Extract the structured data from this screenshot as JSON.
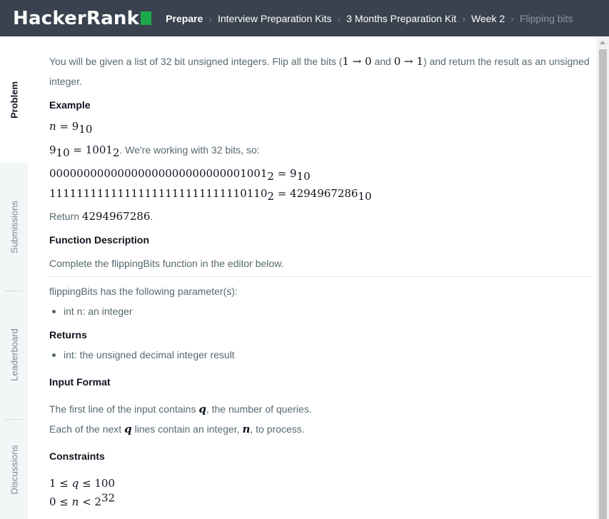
{
  "brand": {
    "name": "HackerRank"
  },
  "breadcrumb": [
    {
      "label": "Prepare"
    },
    {
      "label": "Interview Preparation Kits"
    },
    {
      "label": "3 Months Preparation Kit"
    },
    {
      "label": "Week 2"
    },
    {
      "label": "Flipping bits"
    }
  ],
  "sidebar": {
    "tabs": [
      {
        "label": "Problem"
      },
      {
        "label": "Submissions"
      },
      {
        "label": "Leaderboard"
      },
      {
        "label": "Discussions"
      }
    ]
  },
  "problem": {
    "intro_a": "You will be given a list of 32 bit unsigned integers. Flip all the bits (",
    "intro_m1": "1 → 0",
    "intro_and": " and ",
    "intro_m2": "0 → 1",
    "intro_b": ") and return the result as an unsigned integer.",
    "example_heading": "Example",
    "ex_n": "n",
    "ex_eq1": " = 9",
    "ex_sub10": "10",
    "ex_b1": "9",
    "ex_b2": " = 1001",
    "ex_sub2": "2",
    "ex_working": ". We're working with 32 bits, so:",
    "bin_line1": "00000000000000000000000000001001",
    "bin_line1_rhs": " = 9",
    "bin_line2": "11111111111111111111111111110110",
    "bin_line2_rhs": " = 4294967286",
    "return_pre": "Return ",
    "return_val": "4294967286",
    "return_post": ".",
    "func_heading": "Function Description",
    "func_desc": "Complete the flippingBits function in the editor below.",
    "params_intro": "flippingBits has the following parameter(s):",
    "param_1": "int n: an integer",
    "returns_heading": "Returns",
    "returns_1": "int: the unsigned decimal integer result",
    "input_heading": "Input Format",
    "input_1a": "The first line of the input contains ",
    "input_q": "q",
    "input_1b": ", the number of queries.",
    "input_2a": "Each of the next ",
    "input_2b": " lines contain an integer, ",
    "input_n": "n",
    "input_2c": ", to process.",
    "constraints_heading": "Constraints",
    "c1_a": "1 ≤ ",
    "c1_b": " ≤ 100",
    "c2_a": "0 ≤ ",
    "c2_b": " < 2",
    "c2_sup": "32"
  }
}
